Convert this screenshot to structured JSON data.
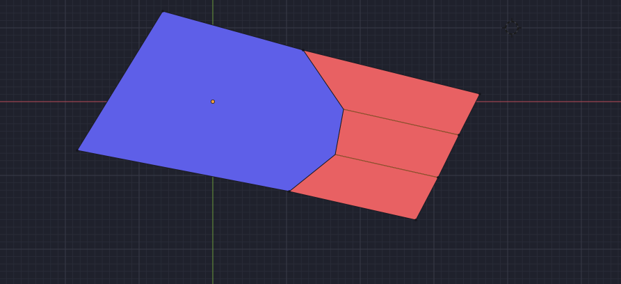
{
  "viewport": {
    "view": "top-orthographic",
    "grid_visible": true,
    "axes_visible": [
      "x",
      "y"
    ]
  },
  "colors": {
    "background": "#1f212c",
    "grid_minor": "#2a2d39",
    "grid_major": "#383b48",
    "x_axis": "#b84a57",
    "y_axis": "#6b9a3a",
    "face_blue": "#5e5fe8",
    "face_red": "#e86163",
    "edge": "#1c1c24",
    "origin": "#f0a040",
    "cursor": "#1a1a1a"
  },
  "objects": [
    {
      "name": "blue-face",
      "color_key": "face_blue",
      "selected": false
    },
    {
      "name": "red-face-strip",
      "color_key": "face_red",
      "segments": 3,
      "selected": false
    }
  ],
  "icons": {
    "cursor": "3d-cursor-icon",
    "origin": "object-origin-icon"
  }
}
